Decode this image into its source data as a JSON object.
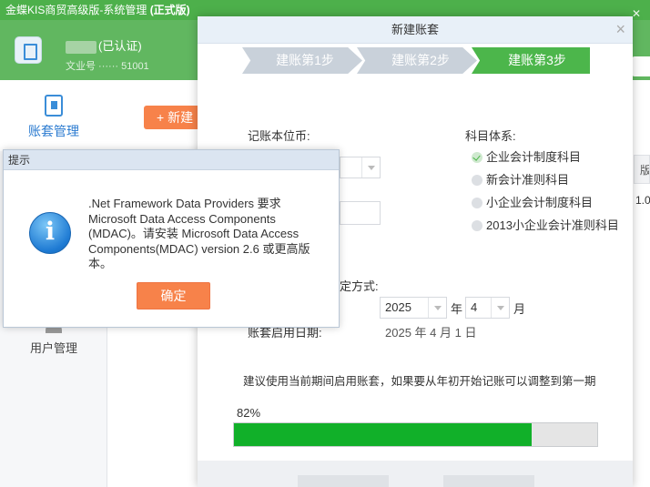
{
  "app": {
    "title": "金蝶KIS商贸高级版-系统管理",
    "edition": "(正式版)",
    "company_status": "(已认证)",
    "subline": "文业号 ······ 51001",
    "nav_account": "账套管理",
    "nav_users": "用户管理",
    "new_account_button": "+ 新建",
    "table_header": "版",
    "table_cell": "1.0"
  },
  "wizard": {
    "title": "新建账套",
    "steps": [
      "建账第1步",
      "建账第2步",
      "建账第3步"
    ],
    "active_step": 3,
    "currency_label": "记账本位币:",
    "subject_system_label": "科目体系:",
    "subject_options": [
      {
        "label": "企业会计制度科目",
        "checked": true
      },
      {
        "label": "新会计准则科目",
        "checked": false
      },
      {
        "label": "小企业会计制度科目",
        "checked": false
      },
      {
        "label": "2013小企业会计准则科目",
        "checked": false
      }
    ],
    "period_method_label": "定方式:",
    "year_value": "2025",
    "year_unit": "年",
    "month_value": "4",
    "month_unit": "月",
    "start_date_label": "账套启用日期:",
    "start_date_value": "2025 年 4 月 1 日",
    "suggestion": "建议使用当前期间启用账套，如果要从年初开始记账可以调整到第一期",
    "progress_text": "82%",
    "progress": 0.82,
    "close_symbol": "×"
  },
  "prompt": {
    "title": "提示",
    "message": ".Net Framework Data Providers 要求 Microsoft Data Access Components (MDAC)。请安装 Microsoft Data Access Components(MDAC) version 2.6 或更高版本。",
    "ok_button": "确定",
    "icon": "info-icon"
  },
  "colors": {
    "brand_green": "#4db04b",
    "header_green": "#61b760",
    "accent_orange": "#f7824a",
    "progress_green": "#11b029",
    "link_blue": "#2b7bd0"
  }
}
